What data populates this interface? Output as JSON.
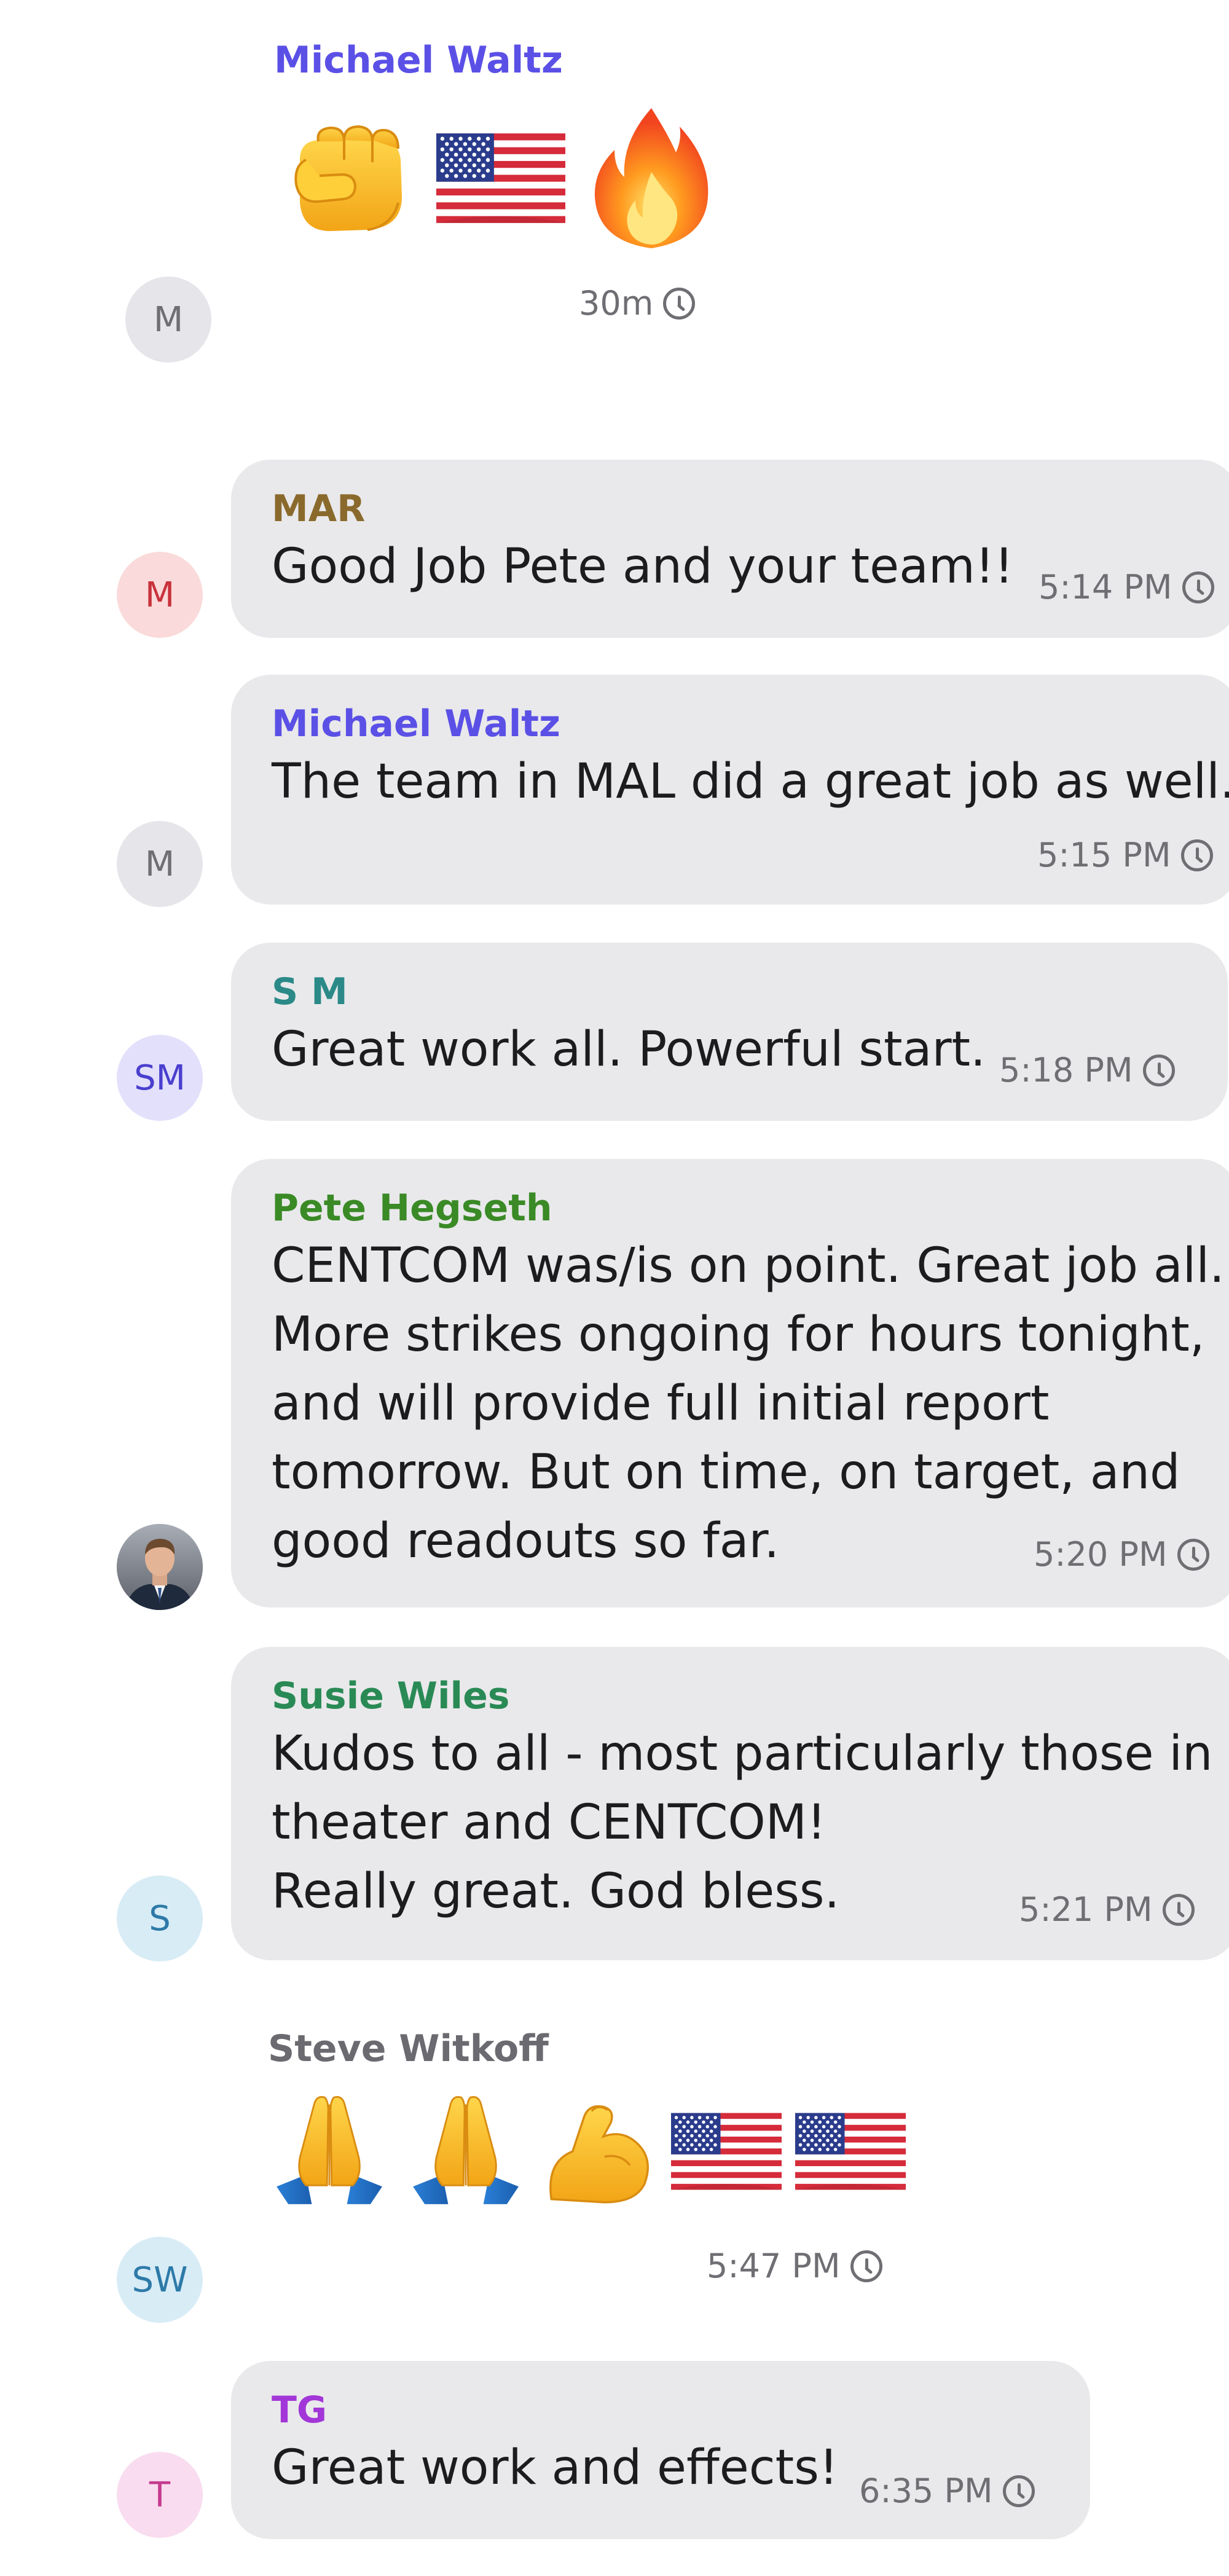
{
  "colors": {
    "bubble": "#e9e9eb",
    "timestamp": "#6e6e73",
    "michael_waltz": "#5b50e6",
    "mar": "#8a6a2c",
    "sm": "#2b8a88",
    "pete_hegseth": "#3a8a26",
    "susie_wiles": "#2a8a55",
    "steve_witkoff": "#6a6a70",
    "tg": "#a236d8"
  },
  "messages": [
    {
      "sender": "Michael Waltz",
      "avatar": "M",
      "emojis": [
        "oncoming-fist-emoji",
        "us-flag-emoji",
        "fire-emoji"
      ],
      "time": "30m"
    },
    {
      "sender": "MAR",
      "avatar": "M",
      "text": [
        "Good Job Pete and your team!!"
      ],
      "time": "5:14 PM"
    },
    {
      "sender": "Michael Waltz",
      "avatar": "M",
      "text": [
        "The team in MAL did a great job  as well."
      ],
      "time": "5:15 PM"
    },
    {
      "sender": "S M",
      "avatar": "SM",
      "text": [
        "Great work all. Powerful start."
      ],
      "time": "5:18 PM"
    },
    {
      "sender": "Pete Hegseth",
      "avatar": "photo",
      "text": [
        "CENTCOM was/is on point. Great job all.",
        "More strikes ongoing for hours tonight,",
        "and will provide full initial report",
        "tomorrow. But on time, on target, and",
        "good readouts so far."
      ],
      "time": "5:20 PM"
    },
    {
      "sender": "Susie Wiles",
      "avatar": "S",
      "text": [
        "Kudos to all - most particularly those in",
        "theater and CENTCOM!",
        "Really great. God bless."
      ],
      "time": "5:21 PM"
    },
    {
      "sender": "Steve Witkoff",
      "avatar": "SW",
      "emojis": [
        "folded-hands-emoji",
        "folded-hands-emoji",
        "flexed-biceps-emoji",
        "us-flag-emoji",
        "us-flag-emoji"
      ],
      "time": "5:47 PM"
    },
    {
      "sender": "TG",
      "avatar": "T",
      "text": [
        "Great work and effects!"
      ],
      "time": "6:35 PM"
    }
  ]
}
